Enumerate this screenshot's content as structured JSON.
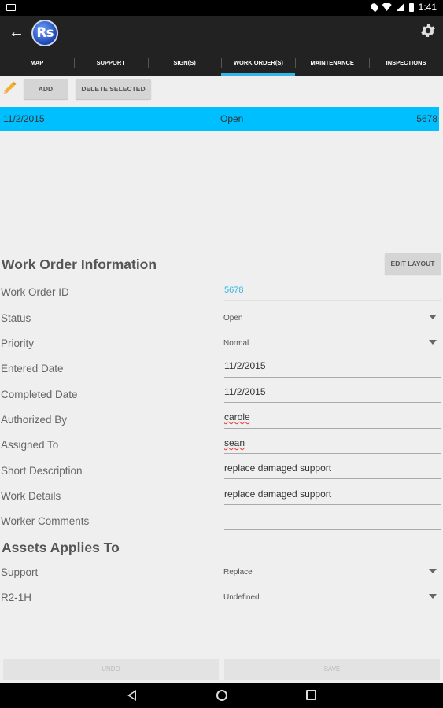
{
  "status_bar": {
    "time": "1:41"
  },
  "app": {
    "logo_text": "Rs"
  },
  "tabs": [
    {
      "label": "MAP"
    },
    {
      "label": "SUPPORT"
    },
    {
      "label": "SIGN(S)"
    },
    {
      "label": "WORK ORDER(S)",
      "active": true
    },
    {
      "label": "MAINTENANCE"
    },
    {
      "label": "INSPECTIONS"
    }
  ],
  "toolbar": {
    "add_label": "ADD",
    "delete_label": "DELETE SELECTED"
  },
  "list": {
    "rows": [
      {
        "date": "11/2/2015",
        "status": "Open",
        "id": "5678"
      }
    ]
  },
  "form": {
    "title": "Work Order Information",
    "edit_layout_label": "EDIT LAYOUT",
    "fields": {
      "work_order_id": {
        "label": "Work Order ID",
        "value": "5678"
      },
      "status": {
        "label": "Status",
        "value": "Open"
      },
      "priority": {
        "label": "Priority",
        "value": "Normal"
      },
      "entered_date": {
        "label": "Entered Date",
        "value": "11/2/2015"
      },
      "completed_date": {
        "label": "Completed Date",
        "value": "11/2/2015"
      },
      "authorized_by": {
        "label": "Authorized By",
        "value": "carole"
      },
      "assigned_to": {
        "label": "Assigned To",
        "value": "sean"
      },
      "short_description": {
        "label": "Short Description",
        "value": "replace damaged support"
      },
      "work_details": {
        "label": "Work Details",
        "value": "replace damaged support"
      },
      "worker_comments": {
        "label": "Worker Comments",
        "value": ""
      }
    }
  },
  "assets": {
    "title": "Assets Applies To",
    "items": [
      {
        "label": "Support",
        "value": "Replace"
      },
      {
        "label": "R2-1H",
        "value": "Undefined"
      }
    ]
  },
  "footer": {
    "undo_label": "UNDO",
    "save_label": "SAVE"
  },
  "colors": {
    "accent": "#33b5e5",
    "selected_row": "#00bfff",
    "appbar": "#222222"
  }
}
